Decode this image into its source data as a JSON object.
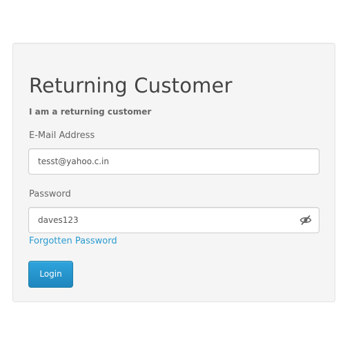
{
  "form": {
    "title": "Returning Customer",
    "subtitle": "I am a returning customer",
    "email": {
      "label": "E-Mail Address",
      "value": "tesst@yahoo.c.in"
    },
    "password": {
      "label": "Password",
      "value": "daves123",
      "toggle_icon": "eye-slash-icon"
    },
    "forgot_link": "Forgotten Password",
    "login_label": "Login"
  },
  "colors": {
    "panel_bg": "#f5f5f5",
    "link": "#2a9bd1",
    "button": "#2396cf"
  }
}
